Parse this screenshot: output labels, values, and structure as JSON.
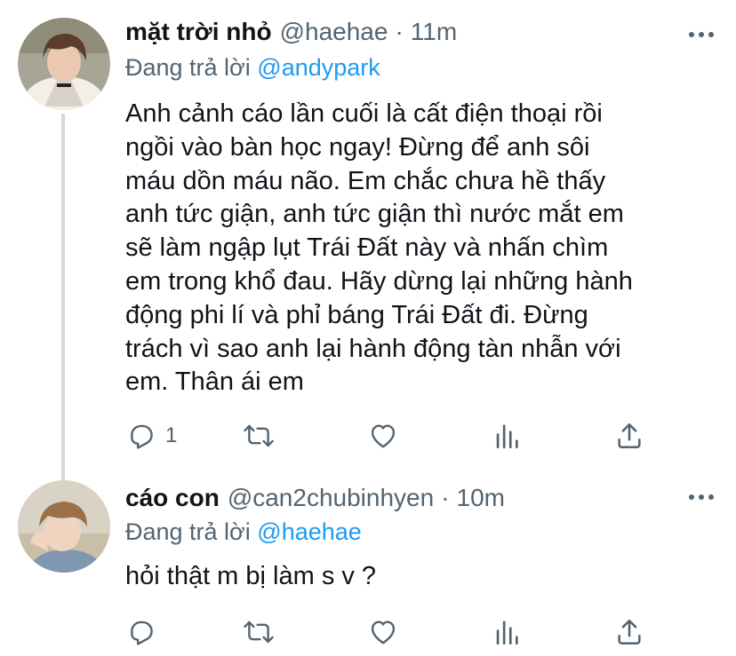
{
  "tweets": [
    {
      "display_name": "mặt trời nhỏ",
      "handle": "@haehae",
      "separator": "·",
      "time": "11m",
      "replying_prefix": "Đang trả lời",
      "replying_to": "@andypark",
      "text": "Anh cảnh cáo lần cuối là cất điện thoại rồi\nngồi vào bàn học ngay! Đừng để anh sôi\nmáu dồn máu não. Em chắc chưa hề thấy\nanh tức giận, anh tức giận thì nước mắt em\nsẽ làm ngập lụt Trái Đất này và nhấn chìm\nem trong khổ đau. Hãy dừng lại những hành\nđộng phi lí và phỉ báng Trái Đất đi. Đừng\ntrách vì sao anh lại hành động tàn nhẫn với\nem. Thân ái em",
      "reply_count": "1",
      "icons": [
        "avatar",
        "more-icon",
        "reply-icon",
        "retweet-icon",
        "like-icon",
        "stats-icon",
        "share-icon"
      ]
    },
    {
      "display_name": "cáo con",
      "handle": "@can2chubinhyen",
      "separator": "·",
      "time": "10m",
      "replying_prefix": "Đang trả lời",
      "replying_to": "@haehae",
      "text": "hỏi thật m bị làm s v ?",
      "reply_count": "",
      "icons": [
        "avatar",
        "more-icon",
        "reply-icon",
        "retweet-icon",
        "like-icon",
        "stats-icon",
        "share-icon"
      ]
    }
  ],
  "colors": {
    "text_primary": "#0f1419",
    "text_secondary": "#536471",
    "accent": "#1d9bf0",
    "thread_line": "#cfd9de",
    "icon_gray": "#536471"
  }
}
